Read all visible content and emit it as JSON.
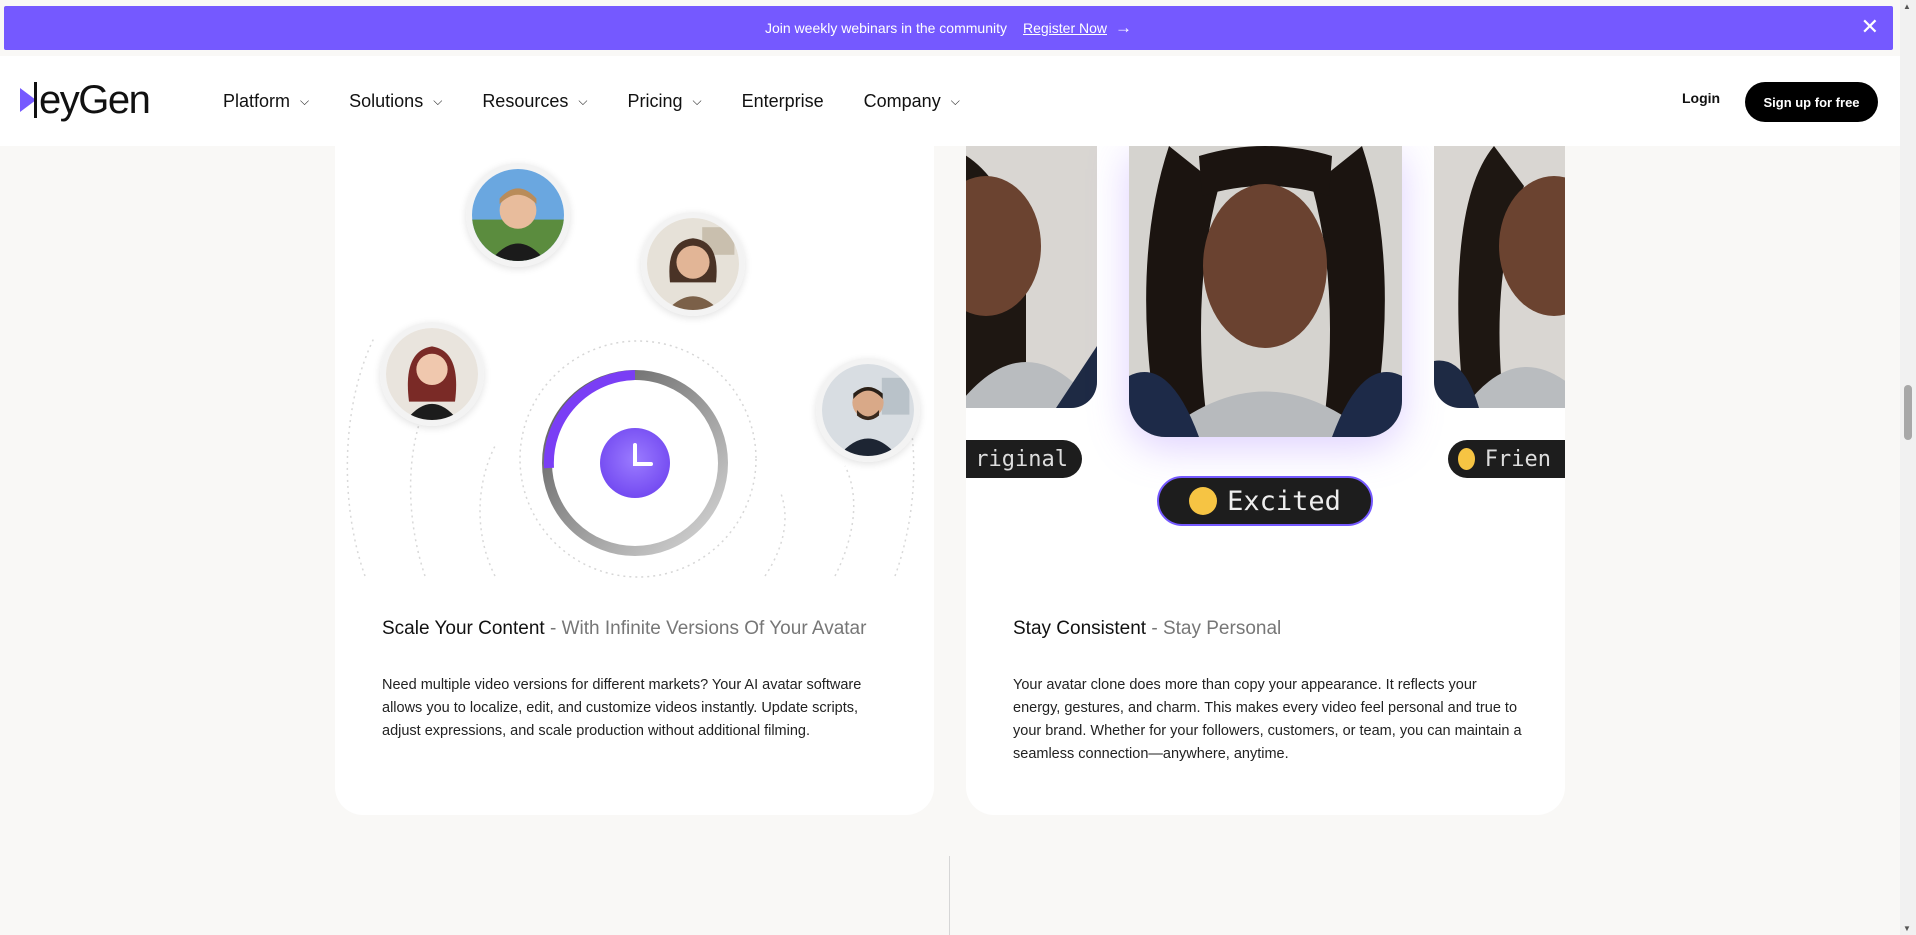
{
  "banner": {
    "text": "Join weekly webinars in the community",
    "link": "Register Now",
    "arrow": "→",
    "close": "✕",
    "bg_color": "#7559ff"
  },
  "header": {
    "logo_text": "eyGen",
    "nav": [
      {
        "label": "Platform",
        "dropdown": true
      },
      {
        "label": "Solutions",
        "dropdown": true
      },
      {
        "label": "Resources",
        "dropdown": true
      },
      {
        "label": "Pricing",
        "dropdown": true
      },
      {
        "label": "Enterprise",
        "dropdown": false
      },
      {
        "label": "Company",
        "dropdown": true
      }
    ],
    "login": "Login",
    "signup": "Sign up for free"
  },
  "cards": {
    "scale": {
      "title": "Scale Your Content",
      "subtitle": " - With Infinite Versions Of Your Avatar",
      "description": "Need multiple video versions for different markets? Your AI avatar software allows you to localize, edit, and customize videos instantly. Update scripts, adjust expressions, and scale production without additional filming."
    },
    "consistent": {
      "title": "Stay Consistent",
      "subtitle": " - Stay Personal",
      "description": "Your avatar clone does more than copy your appearance. It reflects your energy, gestures, and charm. This makes every video feel personal and true to your brand. Whether for your followers, customers, or team, you can maintain a seamless connection—anywhere, anytime.",
      "tags": {
        "left": "riginal",
        "center": "Excited",
        "right": "Frien"
      }
    }
  },
  "icons": {
    "chevron": "chevron-down-icon",
    "clock": "clock-icon",
    "close": "close-icon",
    "arrow": "arrow-right-icon"
  }
}
